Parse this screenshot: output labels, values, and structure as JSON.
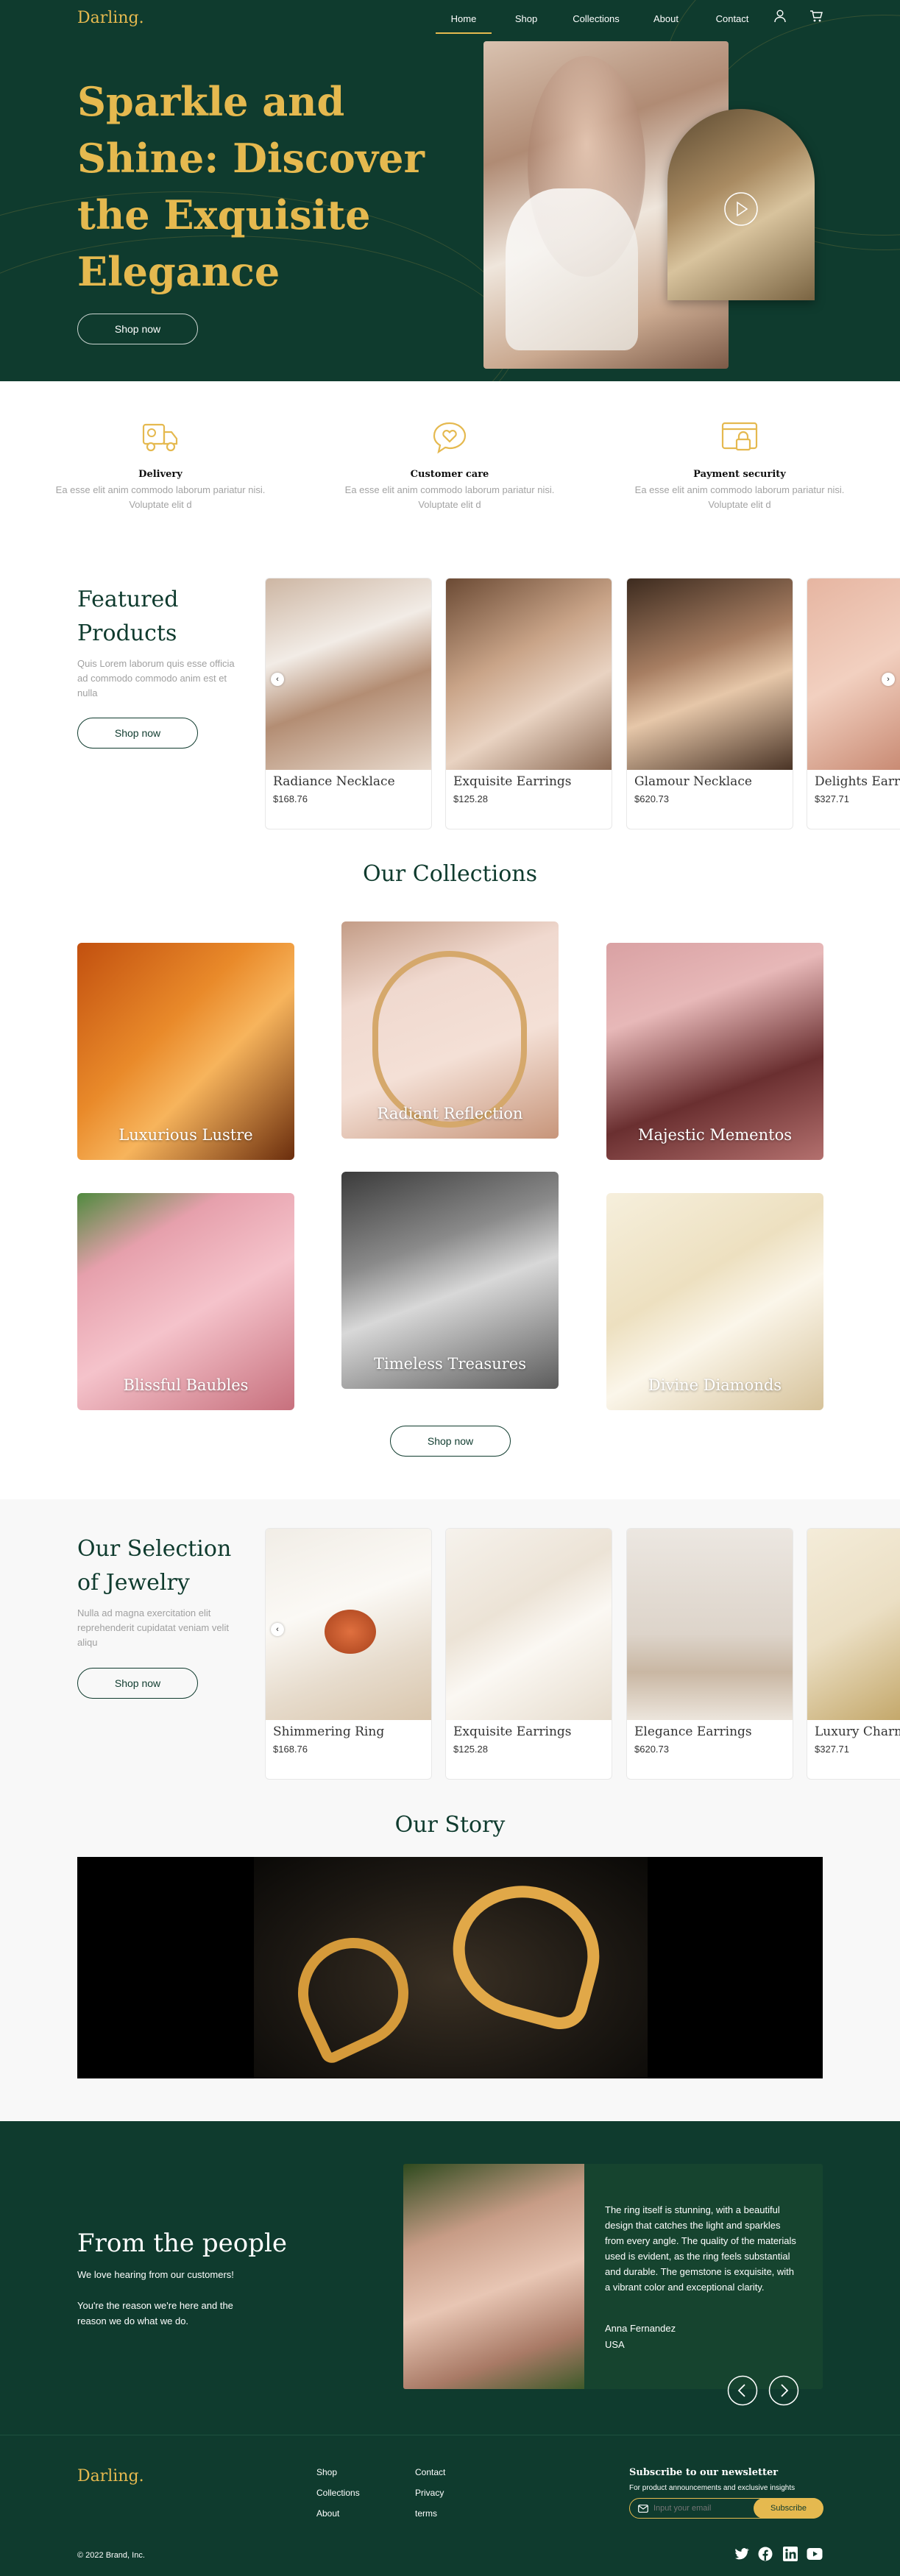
{
  "brand": {
    "logo": "Darling."
  },
  "nav": {
    "items": [
      "Home",
      "Shop",
      "Collections",
      "About",
      "Contact"
    ],
    "user_icon": "user-icon",
    "cart_icon": "cart-icon"
  },
  "hero": {
    "title": "Sparkle and Shine: Discover the Exquisite Elegance",
    "cta": "Shop now",
    "play_icon": "play-icon"
  },
  "features": [
    {
      "icon": "delivery-truck-icon",
      "title": "Delivery",
      "text": "Ea esse elit anim commodo laborum pariatur nisi. Voluptate elit d"
    },
    {
      "icon": "customer-care-heart-icon",
      "title": "Customer care",
      "text": "Ea esse elit anim commodo laborum pariatur nisi. Voluptate elit d"
    },
    {
      "icon": "payment-lock-icon",
      "title": "Payment security",
      "text": "Ea esse elit anim commodo laborum pariatur nisi. Voluptate elit d"
    }
  ],
  "featured": {
    "title": "Featured Products",
    "desc": "Quis Lorem laborum quis esse officia ad commodo commodo anim est et nulla",
    "cta": "Shop now",
    "products": [
      {
        "name": "Radiance Necklace",
        "price": "$168.76"
      },
      {
        "name": "Exquisite Earrings",
        "price": "$125.28"
      },
      {
        "name": "Glamour Necklace",
        "price": "$620.73"
      },
      {
        "name": "Delights Earrin",
        "price": "$327.71"
      }
    ]
  },
  "collections": {
    "title": "Our Collections",
    "items": [
      "Luxurious Lustre",
      "Radiant Reflection",
      "Majestic Mementos",
      "Blissful Baubles",
      "Timeless Treasures",
      "Divine Diamonds"
    ],
    "cta": "Shop now"
  },
  "selection": {
    "title": "Our Selection of Jewelry",
    "desc": "Nulla ad magna exercitation elit reprehenderit cupidatat veniam velit aliqu",
    "cta": "Shop now",
    "products": [
      {
        "name": "Shimmering Ring",
        "price": "$168.76"
      },
      {
        "name": "Exquisite Earrings",
        "price": "$125.28"
      },
      {
        "name": "Elegance Earrings",
        "price": "$620.73"
      },
      {
        "name": "Luxury Charms",
        "price": "$327.71"
      }
    ]
  },
  "story": {
    "title": "Our Story"
  },
  "testimonials": {
    "title": "From the people",
    "desc_line1": "We love hearing from our customers!",
    "desc_line2": "You're the reason we're here and the reason we do what we do.",
    "quote": "The ring itself is stunning, with a beautiful design that catches the light and sparkles from every angle. The quality of the materials used is evident, as the ring feels substantial and durable. The gemstone is exquisite, with a vibrant color and exceptional clarity.",
    "name": "Anna Fernandez",
    "country": "USA"
  },
  "footer": {
    "logo": "Darling.",
    "col1": [
      "Shop",
      "Collections",
      "About"
    ],
    "col2": [
      "Contact",
      "Privacy",
      "terms"
    ],
    "newsletter_title": "Subscribe to our newsletter",
    "newsletter_desc": "For product announcements and exclusive insights",
    "email_placeholder": "Input your email",
    "subscribe": "Subscribe",
    "copyright": "© 2022 Brand, Inc.",
    "social": [
      "twitter-icon",
      "facebook-icon",
      "linkedin-icon",
      "youtube-icon"
    ]
  },
  "colors": {
    "primary": "#0f3b2e",
    "accent": "#e5b94f"
  }
}
